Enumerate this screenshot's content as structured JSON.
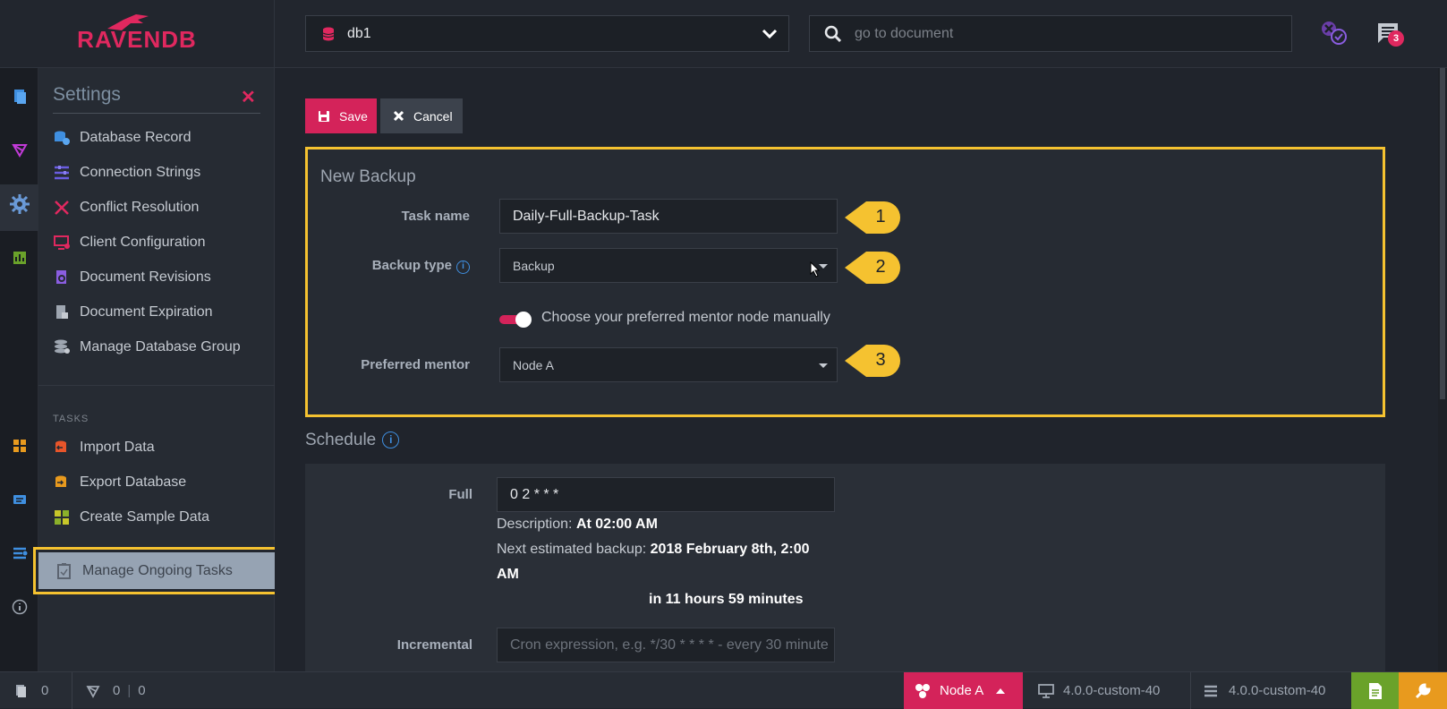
{
  "app": {
    "logo_text": "RAVENDB"
  },
  "header": {
    "database": {
      "name": "db1"
    },
    "search": {
      "placeholder": "go to document"
    },
    "notifications_count": "3"
  },
  "sidebar": {
    "title": "Settings",
    "items": [
      {
        "label": "Database Record",
        "icon": "database-record-icon",
        "color": "#3f8fe0"
      },
      {
        "label": "Connection Strings",
        "icon": "connection-strings-icon",
        "color": "#6a5de0"
      },
      {
        "label": "Conflict Resolution",
        "icon": "conflict-icon",
        "color": "#e0285f"
      },
      {
        "label": "Client Configuration",
        "icon": "client-config-icon",
        "color": "#e0285f"
      },
      {
        "label": "Document Revisions",
        "icon": "revisions-icon",
        "color": "#8a5de0"
      },
      {
        "label": "Document Expiration",
        "icon": "expiration-icon",
        "color": "#9ea6b1"
      },
      {
        "label": "Manage Database Group",
        "icon": "database-group-icon",
        "color": "#9ea6b1"
      }
    ],
    "tasks_section": "TASKS",
    "tasks": [
      {
        "label": "Import Data",
        "icon": "import-icon",
        "color": "#e8552a"
      },
      {
        "label": "Export Database",
        "icon": "export-icon",
        "color": "#e89a1e"
      },
      {
        "label": "Create Sample Data",
        "icon": "sample-data-icon",
        "color": "#c7c72a"
      },
      {
        "label": "Manage Ongoing Tasks",
        "icon": "ongoing-tasks-icon",
        "color": "#5c6470"
      }
    ]
  },
  "toolbar": {
    "save_label": "Save",
    "cancel_label": "Cancel"
  },
  "form": {
    "title": "New Backup",
    "task_name_label": "Task name",
    "task_name_value": "Daily-Full-Backup-Task",
    "backup_type_label": "Backup type",
    "backup_type_value": "Backup",
    "mentor_toggle_label": "Choose your preferred mentor node manually",
    "preferred_mentor_label": "Preferred mentor",
    "preferred_mentor_value": "Node A",
    "callouts": [
      "1",
      "2",
      "3"
    ]
  },
  "schedule": {
    "title": "Schedule",
    "full_label": "Full",
    "full_value": "0 2 * * *",
    "description_label": "Description:",
    "description_value": "At 02:00 AM",
    "next_label": "Next estimated backup:",
    "next_value_1": "2018 February 8th, 2:00",
    "next_value_2": "AM",
    "in_value": "in 11 hours 59 minutes",
    "incremental_label": "Incremental",
    "incremental_placeholder": "Cron expression, e.g. */30 * * * * - every 30 minute"
  },
  "status_bar": {
    "docs_count": "0",
    "indexes_count": "0",
    "errors_count": "0",
    "node_label": "Node A",
    "client_version": "4.0.0-custom-40",
    "server_version": "4.0.0-custom-40"
  },
  "colors": {
    "accent": "#d4235a",
    "highlight": "#f5c230"
  }
}
